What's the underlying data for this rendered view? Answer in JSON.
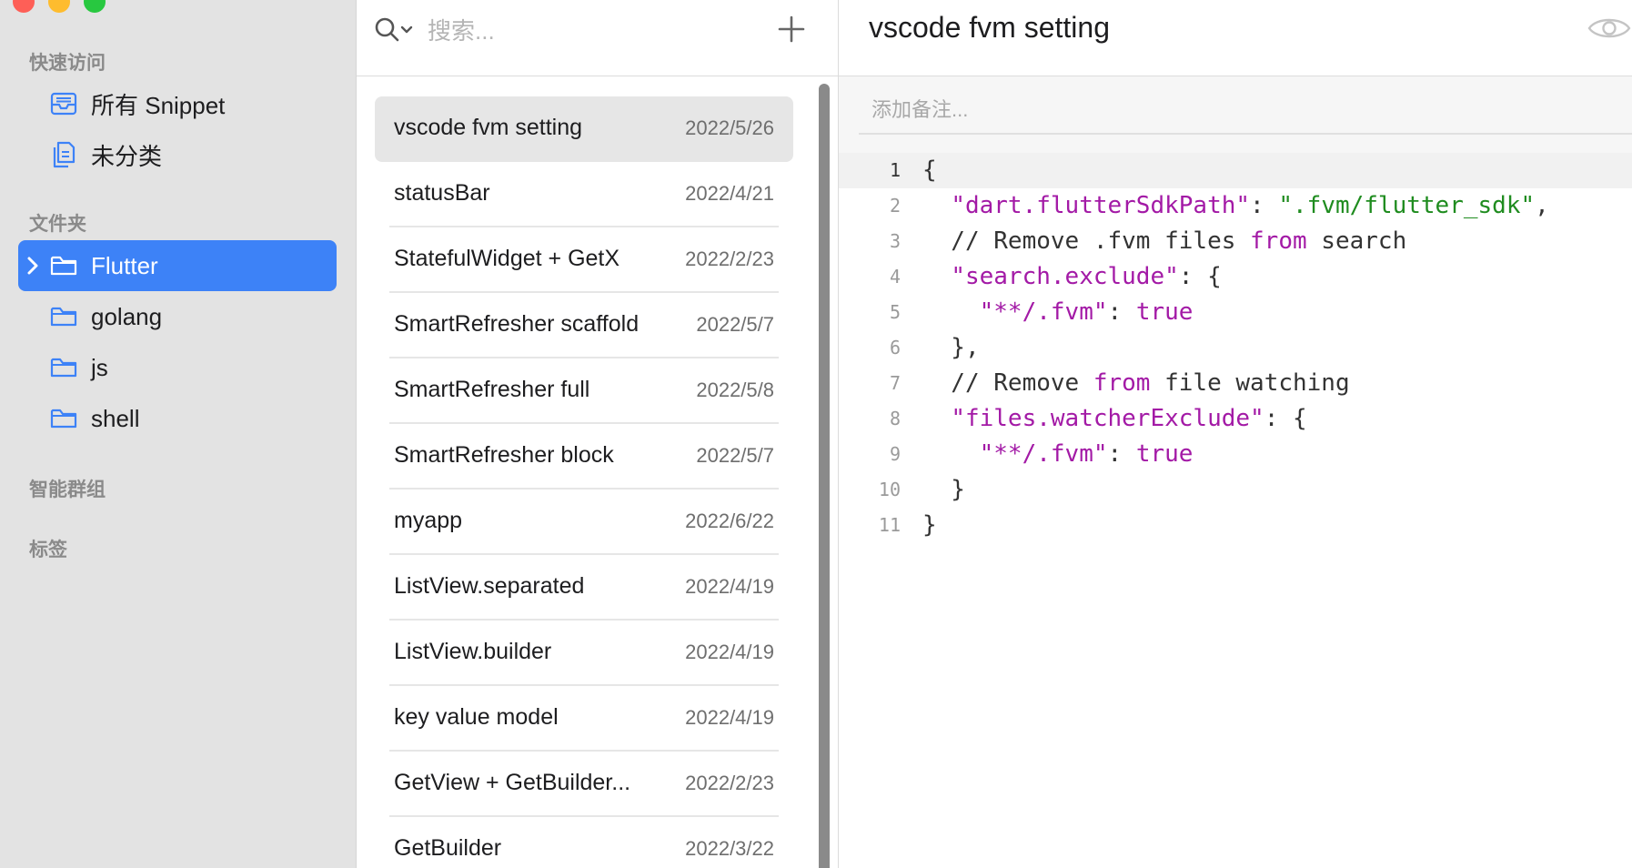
{
  "sidebar": {
    "quick_access": {
      "title": "快速访问",
      "items": [
        {
          "label": "所有 Snippet",
          "icon": "tray-icon"
        },
        {
          "label": "未分类",
          "icon": "documents-icon"
        }
      ]
    },
    "folders": {
      "title": "文件夹",
      "items": [
        {
          "label": "Flutter",
          "icon": "folder-icon",
          "active": true
        },
        {
          "label": "golang",
          "icon": "folder-icon"
        },
        {
          "label": "js",
          "icon": "folder-icon"
        },
        {
          "label": "shell",
          "icon": "folder-icon"
        }
      ]
    },
    "smart_groups": {
      "title": "智能群组"
    },
    "tags": {
      "title": "标签"
    }
  },
  "list_panel": {
    "search": {
      "placeholder": "搜索..."
    },
    "add_icon": "plus-icon",
    "items": [
      {
        "title": "vscode fvm setting",
        "date": "2022/5/26",
        "selected": true
      },
      {
        "title": "statusBar",
        "date": "2022/4/21"
      },
      {
        "title": "StatefulWidget + GetX",
        "date": "2022/2/23"
      },
      {
        "title": "SmartRefresher scaffold",
        "date": "2022/5/7"
      },
      {
        "title": "SmartRefresher full",
        "date": "2022/5/8"
      },
      {
        "title": "SmartRefresher block",
        "date": "2022/5/7"
      },
      {
        "title": "myapp",
        "date": "2022/6/22"
      },
      {
        "title": "ListView.separated",
        "date": "2022/4/19"
      },
      {
        "title": "ListView.builder",
        "date": "2022/4/19"
      },
      {
        "title": "key value model",
        "date": "2022/4/19"
      },
      {
        "title": "GetView + GetBuilder...",
        "date": "2022/2/23"
      },
      {
        "title": "GetBuilder",
        "date": "2022/3/22"
      }
    ]
  },
  "editor": {
    "title": "vscode fvm setting",
    "eye_icon": "eye-icon",
    "notes_placeholder": "添加备注...",
    "current_line": 1,
    "lines": [
      {
        "no": "1",
        "tokens": [
          {
            "t": "{",
            "c": "plain"
          }
        ]
      },
      {
        "no": "2",
        "tokens": [
          {
            "t": "  ",
            "c": "plain"
          },
          {
            "t": "\"dart.flutterSdkPath\"",
            "c": "key"
          },
          {
            "t": ": ",
            "c": "plain"
          },
          {
            "t": "\".fvm/flutter_sdk\"",
            "c": "str"
          },
          {
            "t": ",",
            "c": "plain"
          }
        ]
      },
      {
        "no": "3",
        "tokens": [
          {
            "t": "  // Remove .fvm files ",
            "c": "plain"
          },
          {
            "t": "from",
            "c": "kw"
          },
          {
            "t": " search",
            "c": "plain"
          }
        ]
      },
      {
        "no": "4",
        "tokens": [
          {
            "t": "  ",
            "c": "plain"
          },
          {
            "t": "\"search.exclude\"",
            "c": "key"
          },
          {
            "t": ": {",
            "c": "plain"
          }
        ]
      },
      {
        "no": "5",
        "tokens": [
          {
            "t": "    ",
            "c": "plain"
          },
          {
            "t": "\"**/.fvm\"",
            "c": "key"
          },
          {
            "t": ": ",
            "c": "plain"
          },
          {
            "t": "true",
            "c": "bool"
          }
        ]
      },
      {
        "no": "6",
        "tokens": [
          {
            "t": "  },",
            "c": "plain"
          }
        ]
      },
      {
        "no": "7",
        "tokens": [
          {
            "t": "  // Remove ",
            "c": "plain"
          },
          {
            "t": "from",
            "c": "kw"
          },
          {
            "t": " file watching",
            "c": "plain"
          }
        ]
      },
      {
        "no": "8",
        "tokens": [
          {
            "t": "  ",
            "c": "plain"
          },
          {
            "t": "\"files.watcherExclude\"",
            "c": "key"
          },
          {
            "t": ": {",
            "c": "plain"
          }
        ]
      },
      {
        "no": "9",
        "tokens": [
          {
            "t": "    ",
            "c": "plain"
          },
          {
            "t": "\"**/.fvm\"",
            "c": "key"
          },
          {
            "t": ": ",
            "c": "plain"
          },
          {
            "t": "true",
            "c": "bool"
          }
        ]
      },
      {
        "no": "10",
        "tokens": [
          {
            "t": "  }",
            "c": "plain"
          }
        ]
      },
      {
        "no": "11",
        "tokens": [
          {
            "t": "}",
            "c": "plain"
          }
        ]
      }
    ]
  },
  "colors": {
    "accent": "#3d82f7",
    "sidebar_bg": "#e3e3e3",
    "code_key": "#a31aa6",
    "code_string": "#1f8c1f"
  }
}
